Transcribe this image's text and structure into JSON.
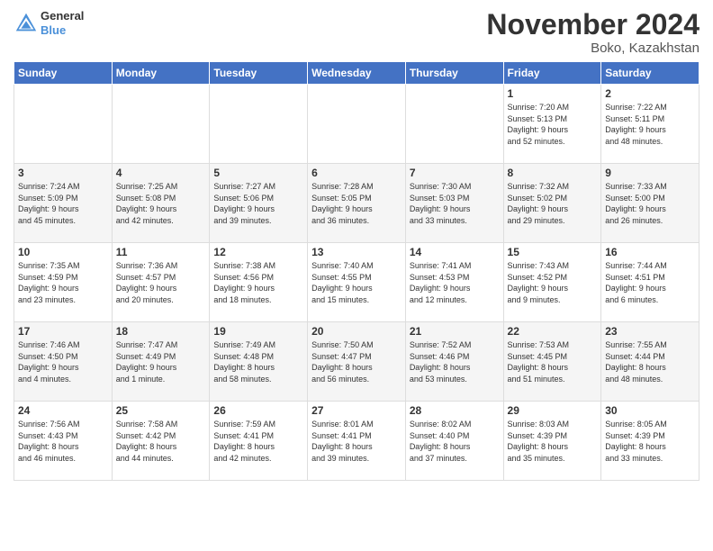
{
  "header": {
    "logo_line1": "General",
    "logo_line2": "Blue",
    "month_title": "November 2024",
    "location": "Boko, Kazakhstan"
  },
  "days_of_week": [
    "Sunday",
    "Monday",
    "Tuesday",
    "Wednesday",
    "Thursday",
    "Friday",
    "Saturday"
  ],
  "weeks": [
    [
      {
        "day": "",
        "info": ""
      },
      {
        "day": "",
        "info": ""
      },
      {
        "day": "",
        "info": ""
      },
      {
        "day": "",
        "info": ""
      },
      {
        "day": "",
        "info": ""
      },
      {
        "day": "1",
        "info": "Sunrise: 7:20 AM\nSunset: 5:13 PM\nDaylight: 9 hours\nand 52 minutes."
      },
      {
        "day": "2",
        "info": "Sunrise: 7:22 AM\nSunset: 5:11 PM\nDaylight: 9 hours\nand 48 minutes."
      }
    ],
    [
      {
        "day": "3",
        "info": "Sunrise: 7:24 AM\nSunset: 5:09 PM\nDaylight: 9 hours\nand 45 minutes."
      },
      {
        "day": "4",
        "info": "Sunrise: 7:25 AM\nSunset: 5:08 PM\nDaylight: 9 hours\nand 42 minutes."
      },
      {
        "day": "5",
        "info": "Sunrise: 7:27 AM\nSunset: 5:06 PM\nDaylight: 9 hours\nand 39 minutes."
      },
      {
        "day": "6",
        "info": "Sunrise: 7:28 AM\nSunset: 5:05 PM\nDaylight: 9 hours\nand 36 minutes."
      },
      {
        "day": "7",
        "info": "Sunrise: 7:30 AM\nSunset: 5:03 PM\nDaylight: 9 hours\nand 33 minutes."
      },
      {
        "day": "8",
        "info": "Sunrise: 7:32 AM\nSunset: 5:02 PM\nDaylight: 9 hours\nand 29 minutes."
      },
      {
        "day": "9",
        "info": "Sunrise: 7:33 AM\nSunset: 5:00 PM\nDaylight: 9 hours\nand 26 minutes."
      }
    ],
    [
      {
        "day": "10",
        "info": "Sunrise: 7:35 AM\nSunset: 4:59 PM\nDaylight: 9 hours\nand 23 minutes."
      },
      {
        "day": "11",
        "info": "Sunrise: 7:36 AM\nSunset: 4:57 PM\nDaylight: 9 hours\nand 20 minutes."
      },
      {
        "day": "12",
        "info": "Sunrise: 7:38 AM\nSunset: 4:56 PM\nDaylight: 9 hours\nand 18 minutes."
      },
      {
        "day": "13",
        "info": "Sunrise: 7:40 AM\nSunset: 4:55 PM\nDaylight: 9 hours\nand 15 minutes."
      },
      {
        "day": "14",
        "info": "Sunrise: 7:41 AM\nSunset: 4:53 PM\nDaylight: 9 hours\nand 12 minutes."
      },
      {
        "day": "15",
        "info": "Sunrise: 7:43 AM\nSunset: 4:52 PM\nDaylight: 9 hours\nand 9 minutes."
      },
      {
        "day": "16",
        "info": "Sunrise: 7:44 AM\nSunset: 4:51 PM\nDaylight: 9 hours\nand 6 minutes."
      }
    ],
    [
      {
        "day": "17",
        "info": "Sunrise: 7:46 AM\nSunset: 4:50 PM\nDaylight: 9 hours\nand 4 minutes."
      },
      {
        "day": "18",
        "info": "Sunrise: 7:47 AM\nSunset: 4:49 PM\nDaylight: 9 hours\nand 1 minute."
      },
      {
        "day": "19",
        "info": "Sunrise: 7:49 AM\nSunset: 4:48 PM\nDaylight: 8 hours\nand 58 minutes."
      },
      {
        "day": "20",
        "info": "Sunrise: 7:50 AM\nSunset: 4:47 PM\nDaylight: 8 hours\nand 56 minutes."
      },
      {
        "day": "21",
        "info": "Sunrise: 7:52 AM\nSunset: 4:46 PM\nDaylight: 8 hours\nand 53 minutes."
      },
      {
        "day": "22",
        "info": "Sunrise: 7:53 AM\nSunset: 4:45 PM\nDaylight: 8 hours\nand 51 minutes."
      },
      {
        "day": "23",
        "info": "Sunrise: 7:55 AM\nSunset: 4:44 PM\nDaylight: 8 hours\nand 48 minutes."
      }
    ],
    [
      {
        "day": "24",
        "info": "Sunrise: 7:56 AM\nSunset: 4:43 PM\nDaylight: 8 hours\nand 46 minutes."
      },
      {
        "day": "25",
        "info": "Sunrise: 7:58 AM\nSunset: 4:42 PM\nDaylight: 8 hours\nand 44 minutes."
      },
      {
        "day": "26",
        "info": "Sunrise: 7:59 AM\nSunset: 4:41 PM\nDaylight: 8 hours\nand 42 minutes."
      },
      {
        "day": "27",
        "info": "Sunrise: 8:01 AM\nSunset: 4:41 PM\nDaylight: 8 hours\nand 39 minutes."
      },
      {
        "day": "28",
        "info": "Sunrise: 8:02 AM\nSunset: 4:40 PM\nDaylight: 8 hours\nand 37 minutes."
      },
      {
        "day": "29",
        "info": "Sunrise: 8:03 AM\nSunset: 4:39 PM\nDaylight: 8 hours\nand 35 minutes."
      },
      {
        "day": "30",
        "info": "Sunrise: 8:05 AM\nSunset: 4:39 PM\nDaylight: 8 hours\nand 33 minutes."
      }
    ]
  ]
}
